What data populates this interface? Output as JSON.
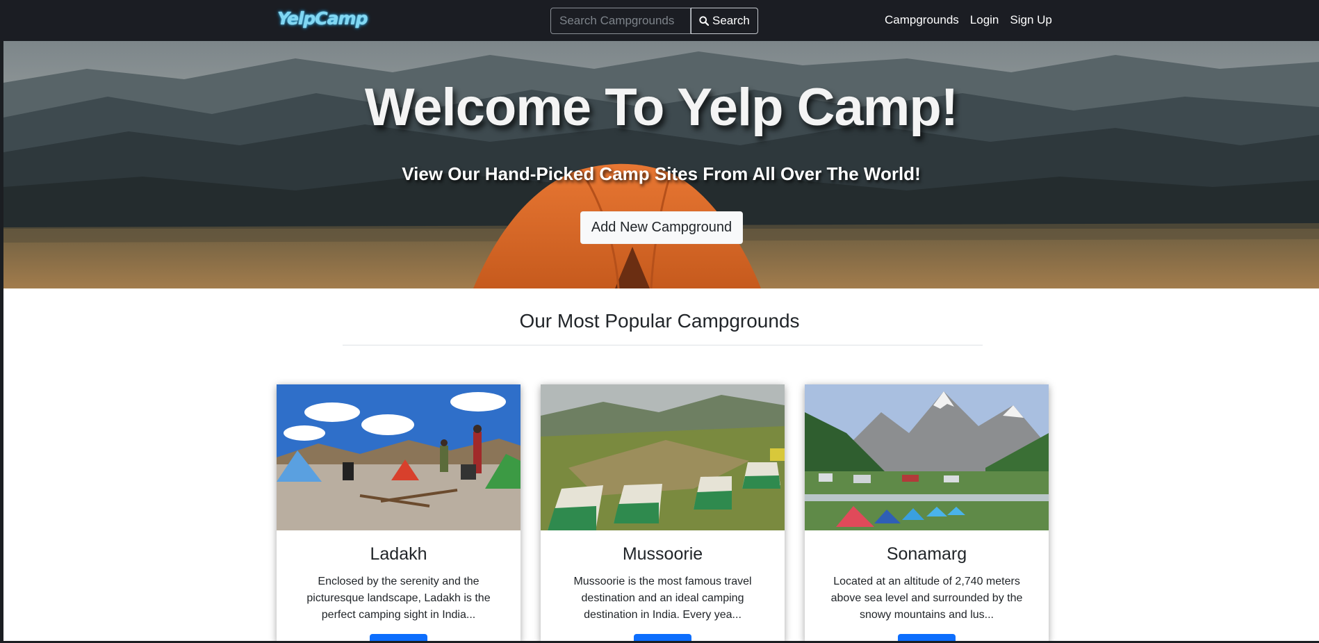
{
  "navbar": {
    "brand": "YelpCamp",
    "search": {
      "placeholder": "Search Campgrounds",
      "button_label": "Search",
      "button_icon": "search-icon"
    },
    "links": [
      "Campgrounds",
      "Login",
      "Sign Up"
    ]
  },
  "hero": {
    "title": "Welcome To Yelp Camp!",
    "subtitle": "View Our Hand-Picked Camp Sites From All Over The World!",
    "button_label": "Add New Campground"
  },
  "section": {
    "title": "Our Most Popular Campgrounds"
  },
  "cards": [
    {
      "title": "Ladakh",
      "text": "Enclosed by the serenity and the picturesque landscape, Ladakh is the perfect camping sight in India..."
    },
    {
      "title": "Mussoorie",
      "text": "Mussoorie is the most famous travel destination and an ideal camping destination in India. Every yea..."
    },
    {
      "title": "Sonamarg",
      "text": "Located at an altitude of 2,740 meters above sea level and surrounded by the snowy mountains and lus..."
    }
  ],
  "colors": {
    "navbar_bg": "#1b1d23",
    "primary_button": "#0d6efd",
    "tent": "#e0692a"
  }
}
